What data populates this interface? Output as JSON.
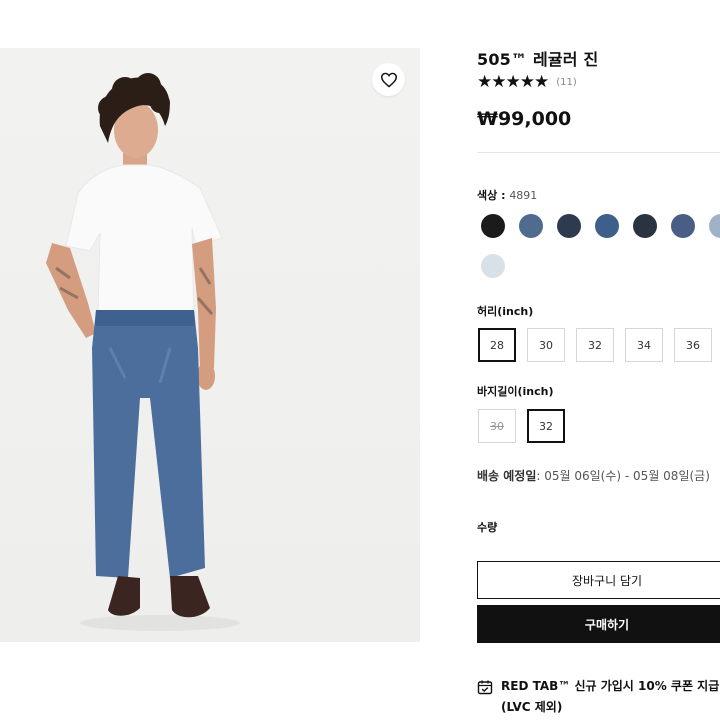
{
  "product": {
    "title": "505™ 레귤러 진",
    "rating_stars": "★★★★★",
    "rating_value": 4.5,
    "review_count": "(11)",
    "price": "₩99,000"
  },
  "color": {
    "label": "색상 : ",
    "value": "4891",
    "swatches": [
      {
        "color": "#1b1b1b"
      },
      {
        "color": "#4f6b8e"
      },
      {
        "color": "#2e3a4e"
      },
      {
        "color": "#3e5f8a"
      },
      {
        "color": "#2a3340"
      },
      {
        "color": "#4a5d85"
      },
      {
        "color": "#9fb2c8"
      },
      {
        "color": "#d9e1e8"
      }
    ]
  },
  "waist": {
    "label": "허리(inch)",
    "sizes": [
      "28",
      "30",
      "32",
      "34",
      "36"
    ],
    "selected": "28"
  },
  "length": {
    "label": "바지길이(inch)",
    "sizes": [
      "30",
      "32"
    ],
    "selected": "32",
    "soldout": [
      "30"
    ]
  },
  "delivery": {
    "label": "배송 예정일",
    "value": ": 05월 06일(수) - 05월 08일(금)"
  },
  "quantity": {
    "label": "수량"
  },
  "buttons": {
    "cart": "장바구니 담기",
    "buy": "구매하기"
  },
  "promo": {
    "text": "RED TAB™ 신규 가입시 10% 쿠폰 지급 (LVC 제외)"
  },
  "icons": {
    "wishlist": "heart-icon",
    "promo": "calendar-check-icon"
  }
}
